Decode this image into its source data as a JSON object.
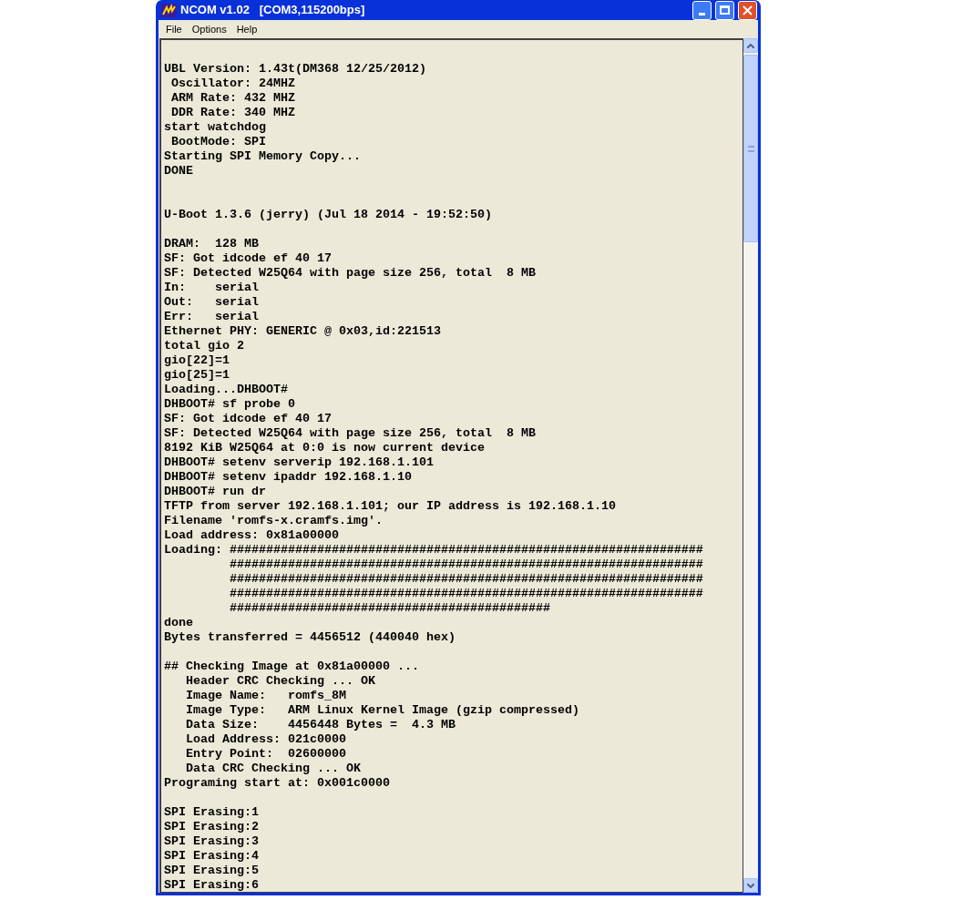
{
  "window": {
    "title": "NCOM v1.02   [COM3,115200bps]"
  },
  "menu": [
    "File",
    "Options",
    "Help"
  ],
  "terminal": {
    "blocks": [
      {
        "kind": "spaced",
        "lines": [
          "UBL Version: 1.43t(DM368 12/25/2012)",
          " Oscillator: 24MHZ",
          " ARM Rate: 432 MHZ",
          " DDR Rate: 340 MHZ",
          "start watchdog",
          " BootMode: SPI",
          "Starting SPI Memory Copy...",
          "DONE"
        ]
      },
      {
        "kind": "double_spaced",
        "lines": [
          "U-Boot 1.3.6 (jerry) (Jul 18 2014 - 19:52:50)"
        ]
      },
      {
        "kind": "spaced",
        "lines": [
          "DRAM:  128 MB",
          "SF: Got idcode ef 40 17",
          "SF: Detected W25Q64 with page size 256, total  8 MB",
          "In:    serial",
          "Out:   serial",
          "Err:   serial",
          "Ethernet PHY: GENERIC @ 0x03,id:221513",
          "total gio 2",
          "gio[22]=1",
          "gio[25]=1",
          "Loading...DHBOOT#",
          "DHBOOT# sf probe 0",
          "SF: Got idcode ef 40 17",
          "SF: Detected W25Q64 with page size 256, total  8 MB",
          "8192 KiB W25Q64 at 0:0 is now current device",
          "DHBOOT# setenv serverip 192.168.1.101",
          "DHBOOT# setenv ipaddr 192.168.1.10",
          "DHBOOT# run dr",
          "TFTP from server 192.168.1.101; our IP address is 192.168.1.10",
          "Filename 'romfs-x.cramfs.img'.",
          "Load address: 0x81a00000",
          "Loading: #################################################################",
          "         #################################################################",
          "         #################################################################",
          "         #################################################################",
          "         ############################################",
          "done",
          "Bytes transferred = 4456512 (440040 hex)"
        ]
      },
      {
        "kind": "spaced",
        "lines": [
          "## Checking Image at 0x81a00000 ...",
          "   Header CRC Checking ... OK",
          "   Image Name:   romfs_8M",
          "   Image Type:   ARM Linux Kernel Image (gzip compressed)",
          "   Data Size:    4456448 Bytes =  4.3 MB",
          "   Load Address: 021c0000",
          "   Entry Point:  02600000",
          "   Data CRC Checking ... OK",
          "Programing start at: 0x001c0000"
        ]
      },
      {
        "kind": "spaced",
        "lines": [
          "SPI Erasing:1",
          "SPI Erasing:2",
          "SPI Erasing:3",
          "SPI Erasing:4",
          "SPI Erasing:5",
          "SPI Erasing:6"
        ]
      }
    ]
  }
}
